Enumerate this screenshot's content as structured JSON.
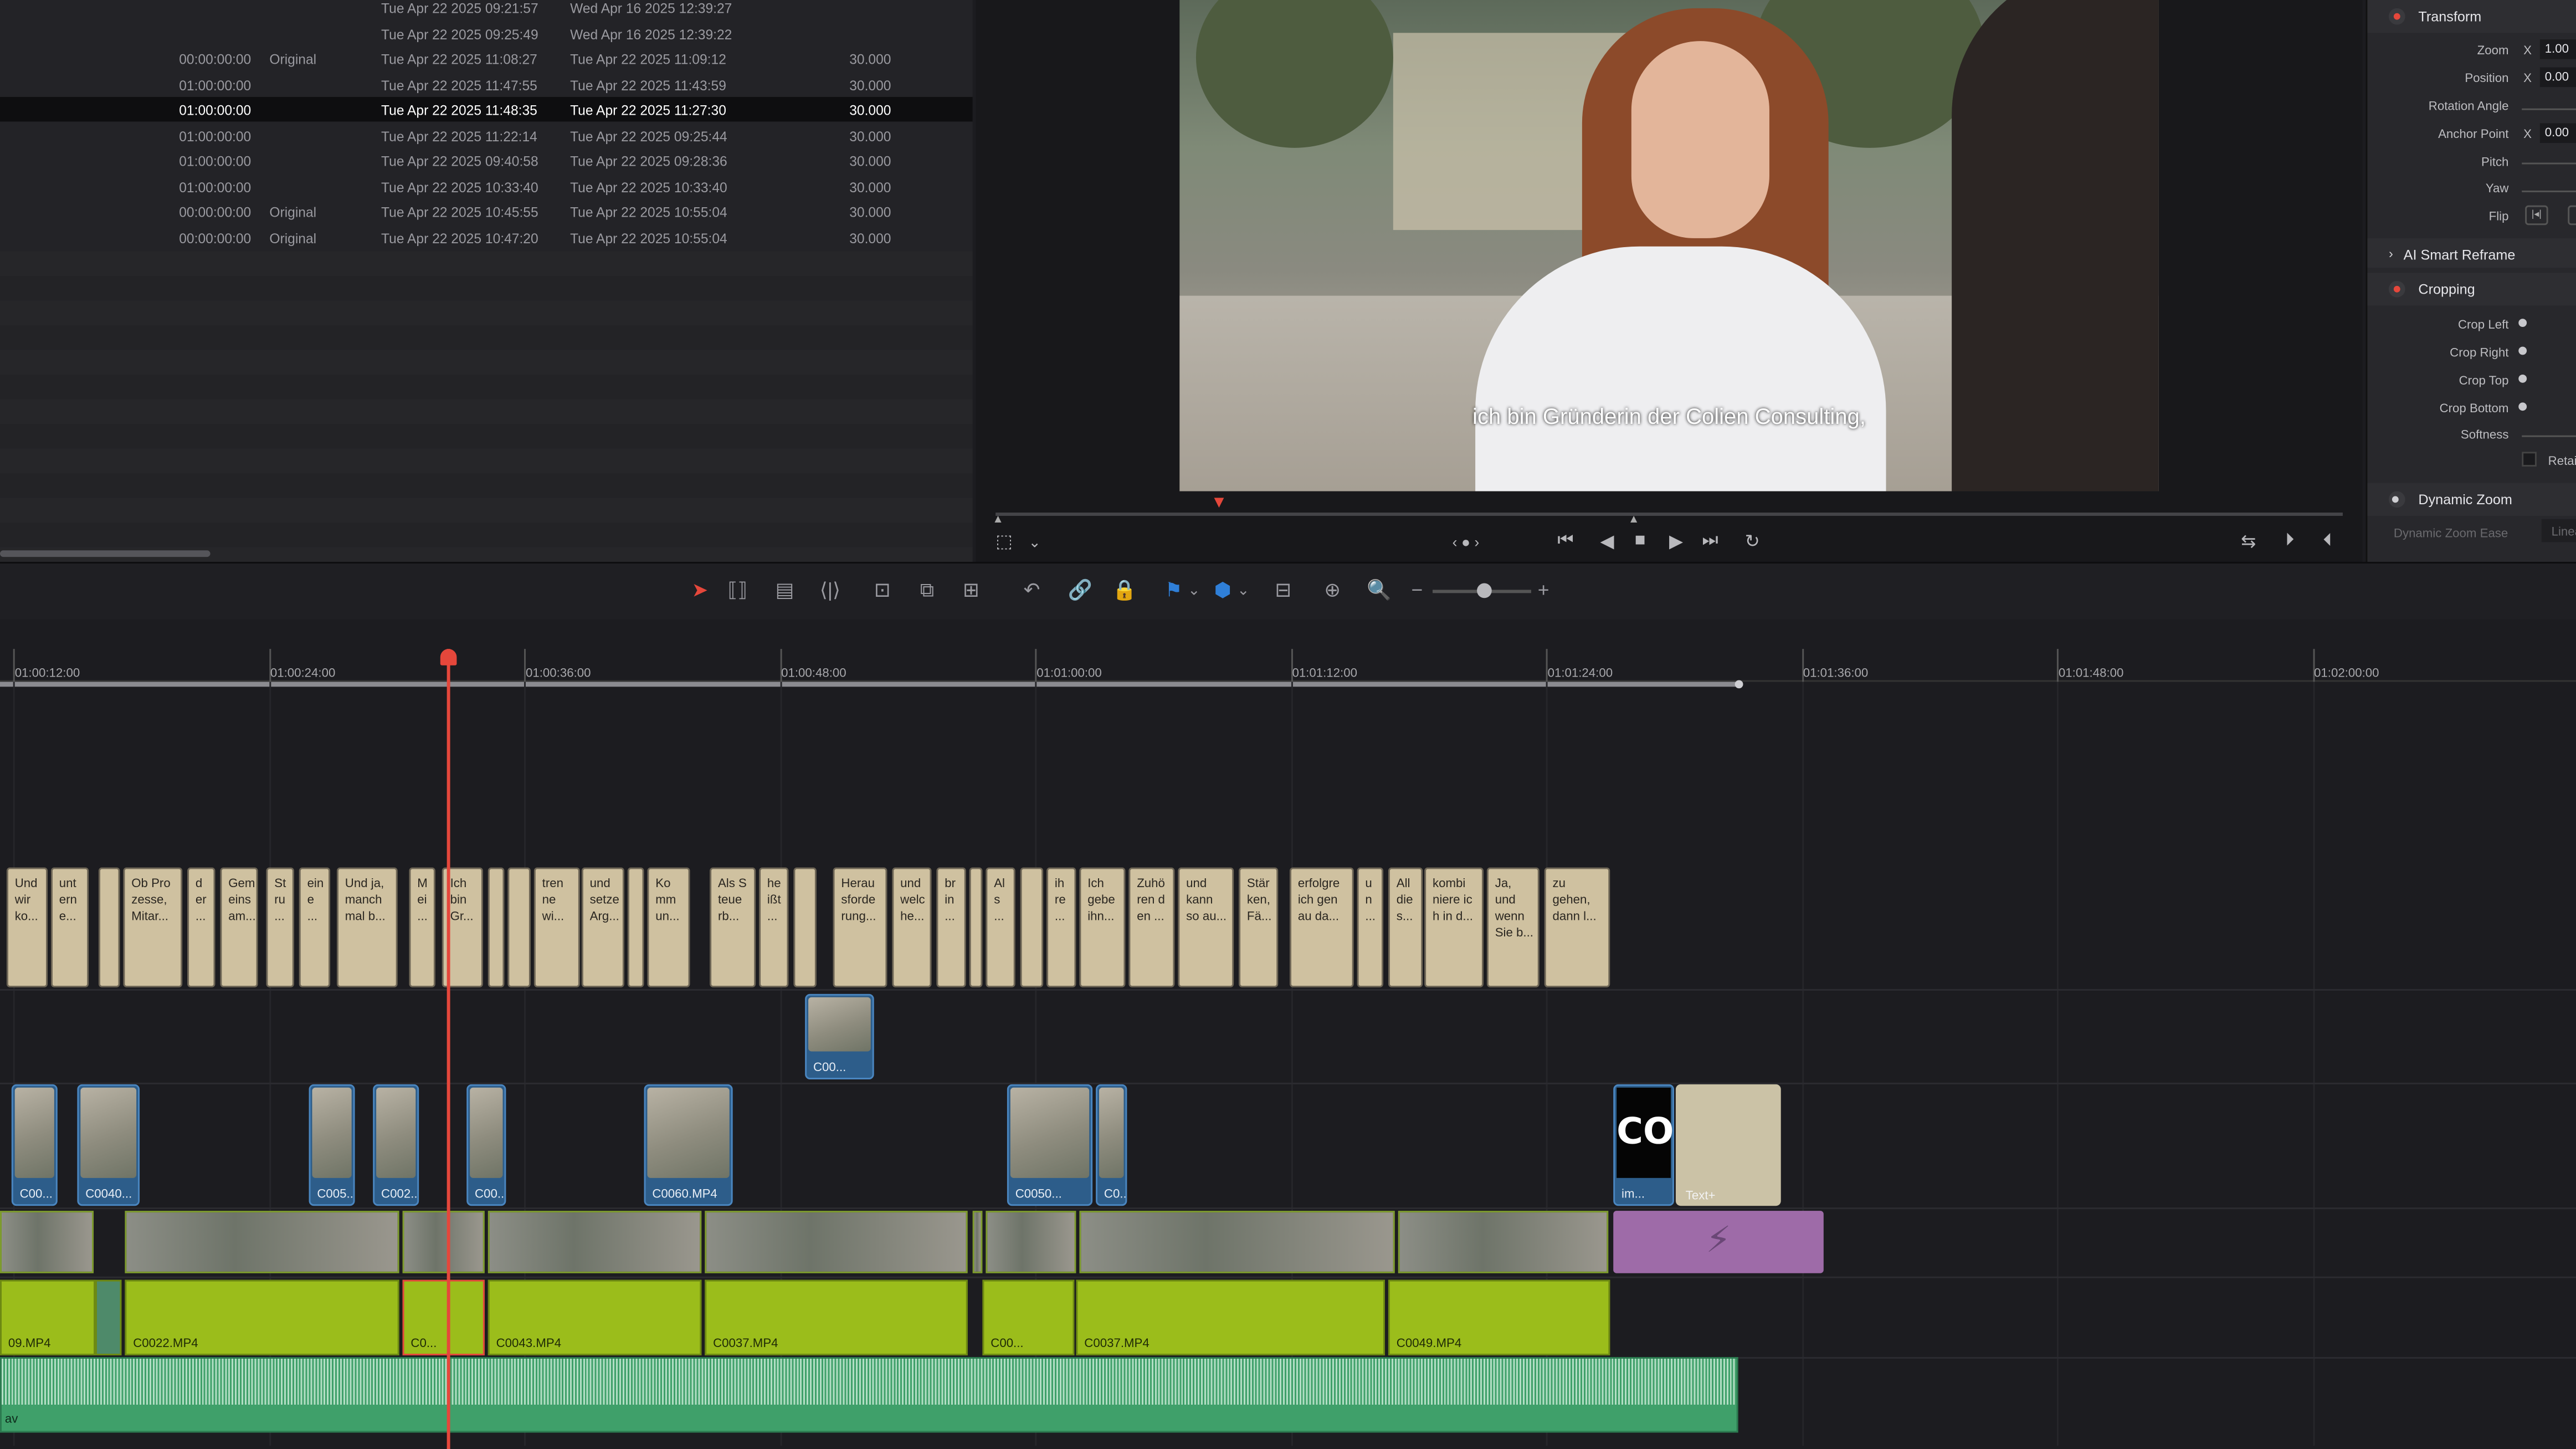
{
  "media_pool": {
    "rows": [
      {
        "tc": "",
        "type": "",
        "date1": "Tue Apr 22 2025 09:21:57",
        "date2": "Wed Apr 16 2025 12:39:27",
        "fps": ""
      },
      {
        "tc": "",
        "type": "",
        "date1": "Tue Apr 22 2025 09:25:49",
        "date2": "Wed Apr 16 2025 12:39:22",
        "fps": ""
      },
      {
        "tc": "00:00:00:00",
        "type": "Original",
        "date1": "Tue Apr 22 2025 11:08:27",
        "date2": "Tue Apr 22 2025 11:09:12",
        "fps": "30.000"
      },
      {
        "tc": "01:00:00:00",
        "type": "",
        "date1": "Tue Apr 22 2025 11:47:55",
        "date2": "Tue Apr 22 2025 11:43:59",
        "fps": "30.000"
      },
      {
        "tc": "01:00:00:00",
        "type": "",
        "date1": "Tue Apr 22 2025 11:48:35",
        "date2": "Tue Apr 22 2025 11:27:30",
        "fps": "30.000"
      },
      {
        "tc": "01:00:00:00",
        "type": "",
        "date1": "Tue Apr 22 2025 11:22:14",
        "date2": "Tue Apr 22 2025 09:25:44",
        "fps": "30.000"
      },
      {
        "tc": "01:00:00:00",
        "type": "",
        "date1": "Tue Apr 22 2025 09:40:58",
        "date2": "Tue Apr 22 2025 09:28:36",
        "fps": "30.000"
      },
      {
        "tc": "01:00:00:00",
        "type": "",
        "date1": "Tue Apr 22 2025 10:33:40",
        "date2": "Tue Apr 22 2025 10:33:40",
        "fps": "30.000"
      },
      {
        "tc": "00:00:00:00",
        "type": "Original",
        "date1": "Tue Apr 22 2025 10:45:55",
        "date2": "Tue Apr 22 2025 10:55:04",
        "fps": "30.000"
      },
      {
        "tc": "00:00:00:00",
        "type": "Original",
        "date1": "Tue Apr 22 2025 10:47:20",
        "date2": "Tue Apr 22 2025 10:55:04",
        "fps": "30.000"
      }
    ],
    "selected_row": 4
  },
  "viewer": {
    "subtitle": "ich bin Gründerin der Colien Consulting,"
  },
  "inspector": {
    "transform": {
      "title": "Transform",
      "zoom_label": "Zoom",
      "zoom_axis": "X",
      "zoom_value": "1.00",
      "position_label": "Position",
      "position_axis": "X",
      "position_value": "0.00",
      "rotation_label": "Rotation Angle",
      "anchor_label": "Anchor Point",
      "anchor_axis": "X",
      "anchor_value": "0.00",
      "pitch_label": "Pitch",
      "yaw_label": "Yaw",
      "flip_label": "Flip"
    },
    "smart_reframe": "AI Smart Reframe",
    "cropping": {
      "title": "Cropping",
      "left": "Crop Left",
      "right": "Crop Right",
      "top": "Crop Top",
      "bottom": "Crop Bottom",
      "softness": "Softness",
      "retain": "Retai"
    },
    "dynamic_zoom": {
      "title": "Dynamic Zoom",
      "ease_label": "Dynamic Zoom Ease",
      "ease_value": "Linear"
    }
  },
  "timeline": {
    "ruler_labels": [
      "01:00:12:00",
      "01:00:24:00",
      "01:00:36:00",
      "01:00:48:00",
      "01:01:00:00",
      "01:01:12:00",
      "01:01:24:00",
      "01:01:36:00",
      "01:01:48:00",
      "01:02:00:00"
    ],
    "subtitles": [
      "Und\nwir\nko...",
      "unt\nern\ne...",
      "",
      "Ob Pro\nzesse,\nMitar...",
      "d\ner\n...",
      "Gem\neins\nam...",
      "St\nru\n...",
      "ein\ne\n...",
      "Und ja,\nmanch\nmal b...",
      "M\nei\n...",
      "Ich\nbin\nGr...",
      "",
      "",
      "tren\nne\nwi...",
      "und\nsetze\nArg...",
      "",
      "Ko\nmm\nun...",
      "Als S\nteue\nrb...",
      "he\nißt\n...",
      "",
      "Herau\nsforde\nrung...",
      "und\nwelc\nhe...",
      "br\nin\n...",
      "",
      "Al\ns\n...",
      "",
      "ih\nre\n...",
      "Ich\ngebe\nihn...",
      "Zuhö\nren d\nen ...",
      "und\nkann\nso au...",
      "Stär\nken,\nFä...",
      "erfolgre\nich gen\nau da...",
      "u\nn\n...",
      "All\ndie\ns...",
      "kombi\nniere ic\nh in d...",
      "Ja, und\nwenn\nSie b...",
      "zu\ngehen,\ndann l..."
    ],
    "v3_clip": "C00...",
    "v2_clips": [
      "C00...",
      "C0040...",
      "C005...",
      "C002...",
      "C00...",
      "C0060.MP4",
      "C0050...",
      "C0..."
    ],
    "image_clip": "im...",
    "logo_text": "CO",
    "text_clip": "Text+",
    "a1_clips": [
      "09.MP4",
      "C0022.MP4",
      "C0...",
      "C0043.MP4",
      "C0037.MP4",
      "C00...",
      "C0037.MP4",
      "C0049.MP4"
    ],
    "a2_clip": "av"
  },
  "colors": {
    "playhead": "#e5473b",
    "audio_a1": "#9bbd1b",
    "audio_a2": "#3fa06a",
    "video_clip": "#2d5d8a",
    "subtitle_clip": "#cfc1a0",
    "fusion_clip": "#9e6ba8"
  }
}
